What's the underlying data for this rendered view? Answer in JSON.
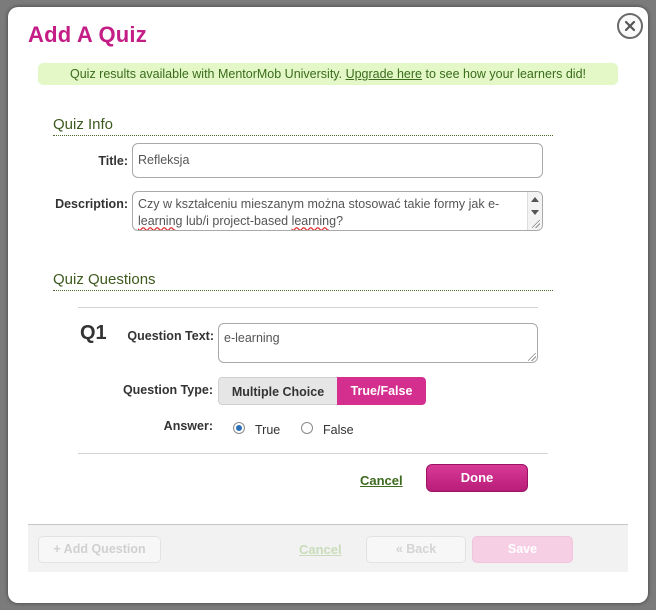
{
  "dialog": {
    "title": "Add A Quiz",
    "banner": {
      "prefix": "Quiz results available with MentorMob University. ",
      "link": "Upgrade here",
      "suffix": " to see how your learners did!"
    }
  },
  "quiz_info": {
    "heading": "Quiz Info",
    "title_label": "Title:",
    "title_value": "Refleksja",
    "description_label": "Description:",
    "description_parts": [
      "Czy w kształceniu mieszanym można stosować takie formy jak e-",
      "learning",
      " lub/i project-based ",
      "learning",
      "?"
    ]
  },
  "quiz_questions": {
    "heading": "Quiz Questions",
    "question": {
      "number": "Q1",
      "text_label": "Question Text:",
      "text_value": "e-learning",
      "type_label": "Question Type:",
      "type_options": [
        "Multiple Choice",
        "True/False"
      ],
      "type_selected": "True/False",
      "answer_label": "Answer:",
      "answer_options": [
        "True",
        "False"
      ],
      "answer_selected": "True",
      "cancel_label": "Cancel",
      "done_label": "Done"
    }
  },
  "footer": {
    "add_question": "+ Add Question",
    "cancel": "Cancel",
    "back": "« Back",
    "save": "Save"
  },
  "icons": {
    "close": "close-icon"
  },
  "colors": {
    "accent": "#c41e86",
    "green_text": "#3d5a1f",
    "banner_bg": "#e3f8c6"
  }
}
